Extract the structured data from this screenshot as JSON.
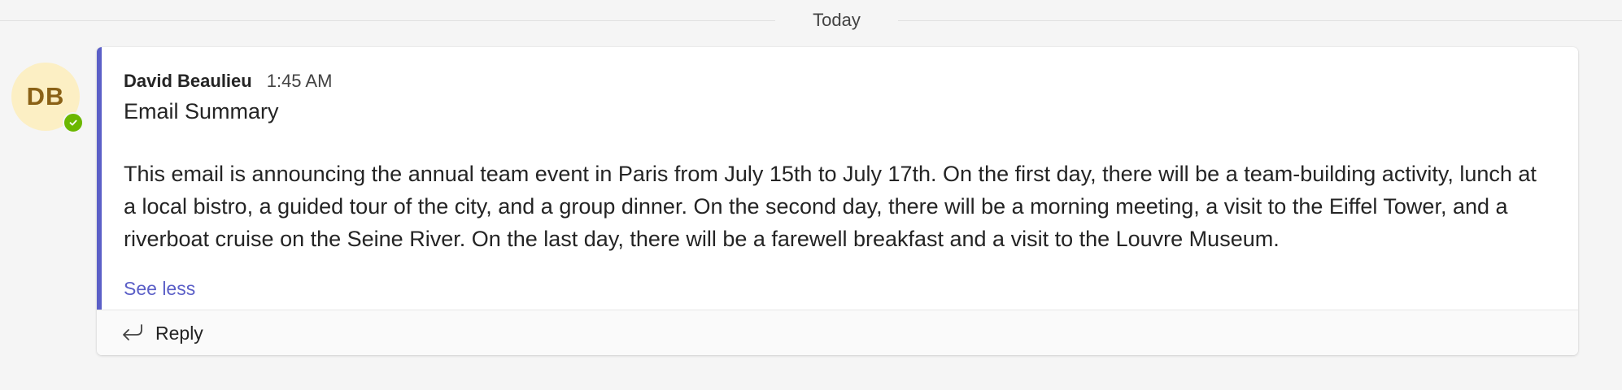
{
  "day_separator": {
    "label": "Today"
  },
  "avatar": {
    "initials": "DB",
    "presence_icon": "available-check-icon",
    "background_color": "#fcefc4",
    "text_color": "#8a6116",
    "presence_color": "#6bb700"
  },
  "message": {
    "author": "David Beaulieu",
    "time": "1:45 AM",
    "subject": "Email Summary",
    "body": "This email is announcing the annual team event in Paris from July 15th to July 17th. On the first day, there will be a team-building activity, lunch at a local bistro, a guided tour of the city, and a group dinner. On the second day, there will be a morning meeting, a visit to the Eiffel Tower, and a riverboat cruise on the Seine River. On the last day, there will be a farewell breakfast and a visit to the Louvre Museum.",
    "see_less_label": "See less",
    "accent_color": "#5b5fc7"
  },
  "actions": {
    "reply_label": "Reply",
    "reply_icon": "reply-arrow-icon"
  }
}
